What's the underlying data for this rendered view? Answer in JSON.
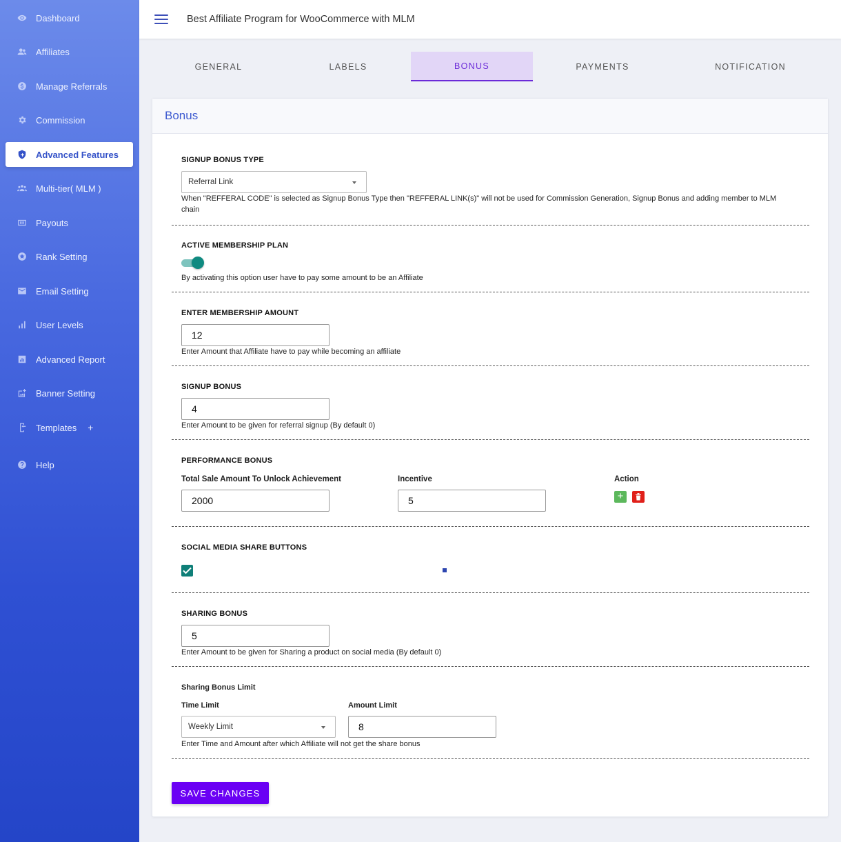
{
  "app": {
    "title": "Best Affiliate Program for WooCommerce with MLM"
  },
  "sidebar": {
    "items": [
      {
        "label": "Dashboard",
        "icon": "eye-icon"
      },
      {
        "label": "Affiliates",
        "icon": "users-icon"
      },
      {
        "label": "Manage Referrals",
        "icon": "referral-icon"
      },
      {
        "label": "Commission",
        "icon": "gear-icon"
      },
      {
        "label": "Advanced Features",
        "icon": "shield-plus-icon",
        "active": true
      },
      {
        "label": "Multi-tier( MLM )",
        "icon": "group-icon"
      },
      {
        "label": "Payouts",
        "icon": "money-icon"
      },
      {
        "label": "Rank Setting",
        "icon": "star-badge-icon"
      },
      {
        "label": "Email Setting",
        "icon": "mail-icon"
      },
      {
        "label": "User Levels",
        "icon": "bar-chart-icon"
      },
      {
        "label": "Advanced Report",
        "icon": "report-icon"
      },
      {
        "label": "Banner Setting",
        "icon": "image-add-icon"
      },
      {
        "label": "Templates",
        "icon": "template-icon",
        "suffix": "+"
      },
      {
        "label": "Help",
        "icon": "help-icon"
      }
    ]
  },
  "tabs": [
    "GENERAL",
    "LABELS",
    "BONUS",
    "PAYMENTS",
    "NOTIFICATION"
  ],
  "active_tab": "BONUS",
  "card": {
    "title": "Bonus"
  },
  "signup_bonus_type": {
    "label": "SIGNUP BONUS TYPE",
    "selected": "Referral Link",
    "help": "When \"REFFERAL CODE\" is selected as Signup Bonus Type then \"REFFERAL LINK(s)\" will not be used for Commission Generation, Signup Bonus and adding member to MLM chain"
  },
  "membership_plan": {
    "label": "ACTIVE MEMBERSHIP PLAN",
    "enabled": true,
    "help": "By activating this option user have to pay some amount to be an Affiliate"
  },
  "membership_amount": {
    "label": "ENTER MEMBERSHIP AMOUNT",
    "value": "12",
    "help": "Enter Amount that Affiliate have to pay while becoming an affiliate"
  },
  "signup_bonus": {
    "label": "SIGNUP BONUS",
    "value": "4",
    "help": "Enter Amount to be given for referral signup (By default 0)"
  },
  "performance_bonus": {
    "label": "PERFORMANCE BONUS",
    "col_amount": "Total Sale Amount To Unlock Achievement",
    "col_incentive": "Incentive",
    "col_action": "Action",
    "amount": "2000",
    "incentive": "5",
    "add_label": "+"
  },
  "social_share": {
    "label": "SOCIAL MEDIA SHARE BUTTONS",
    "checked": true
  },
  "sharing_bonus": {
    "label": "SHARING BONUS",
    "value": "5",
    "help": "Enter Amount to be given for Sharing a product on social media (By default 0)"
  },
  "sharing_limit": {
    "label": "Sharing Bonus Limit",
    "time_label": "Time Limit",
    "time_selected": "Weekly Limit",
    "amount_label": "Amount Limit",
    "amount_value": "8",
    "help": "Enter Time and Amount after which Affiliate will not get the share bonus"
  },
  "save_label": "SAVE CHANGES",
  "colors": {
    "accent": "#6a00f4",
    "sidebar_top": "#6c8bea",
    "sidebar_bottom": "#2445c8",
    "toggle": "#0f8a80",
    "add": "#5cb85c",
    "delete": "#e0201a"
  }
}
